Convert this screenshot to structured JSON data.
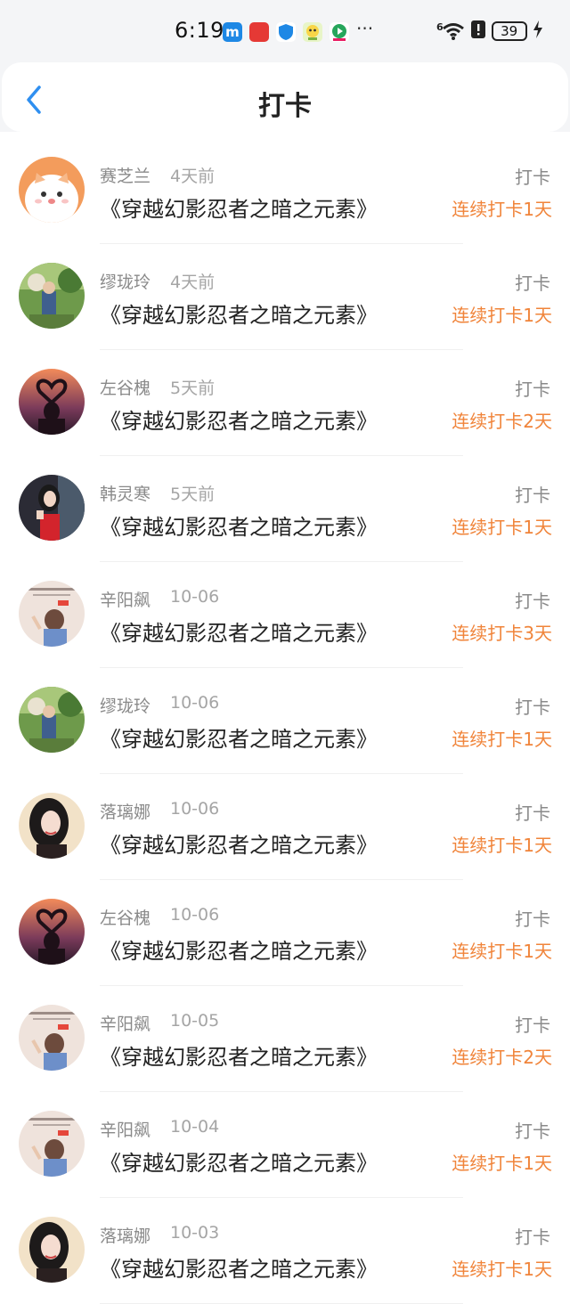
{
  "status_bar": {
    "time": "6:19",
    "battery": "39",
    "more": "···",
    "network": "6"
  },
  "header": {
    "title": "打卡"
  },
  "colors": {
    "accent_orange": "#f0843a",
    "back_blue": "#2f8ff0"
  },
  "checkins": [
    {
      "user": "赛芝兰",
      "time": "4天前",
      "book": "《穿越幻影忍者之暗之元素》",
      "action": "打卡",
      "streak": "连续打卡1天",
      "avatar": "cartoon-dog"
    },
    {
      "user": "缪珑玲",
      "time": "4天前",
      "book": "《穿越幻影忍者之暗之元素》",
      "action": "打卡",
      "streak": "连续打卡1天",
      "avatar": "girl-garden"
    },
    {
      "user": "左谷槐",
      "time": "5天前",
      "book": "《穿越幻影忍者之暗之元素》",
      "action": "打卡",
      "streak": "连续打卡2天",
      "avatar": "sunset-heart"
    },
    {
      "user": "韩灵寒",
      "time": "5天前",
      "book": "《穿越幻影忍者之暗之元素》",
      "action": "打卡",
      "streak": "连续打卡1天",
      "avatar": "girl-red-dress"
    },
    {
      "user": "辛阳飙",
      "time": "10-06",
      "book": "《穿越幻影忍者之暗之元素》",
      "action": "打卡",
      "streak": "连续打卡3天",
      "avatar": "illustration-girl"
    },
    {
      "user": "缪珑玲",
      "time": "10-06",
      "book": "《穿越幻影忍者之暗之元素》",
      "action": "打卡",
      "streak": "连续打卡1天",
      "avatar": "girl-garden"
    },
    {
      "user": "落璃娜",
      "time": "10-06",
      "book": "《穿越幻影忍者之暗之元素》",
      "action": "打卡",
      "streak": "连续打卡1天",
      "avatar": "girl-portrait"
    },
    {
      "user": "左谷槐",
      "time": "10-06",
      "book": "《穿越幻影忍者之暗之元素》",
      "action": "打卡",
      "streak": "连续打卡1天",
      "avatar": "sunset-heart"
    },
    {
      "user": "辛阳飙",
      "time": "10-05",
      "book": "《穿越幻影忍者之暗之元素》",
      "action": "打卡",
      "streak": "连续打卡2天",
      "avatar": "illustration-girl"
    },
    {
      "user": "辛阳飙",
      "time": "10-04",
      "book": "《穿越幻影忍者之暗之元素》",
      "action": "打卡",
      "streak": "连续打卡1天",
      "avatar": "illustration-girl"
    },
    {
      "user": "落璃娜",
      "time": "10-03",
      "book": "《穿越幻影忍者之暗之元素》",
      "action": "打卡",
      "streak": "连续打卡1天",
      "avatar": "girl-portrait"
    }
  ]
}
